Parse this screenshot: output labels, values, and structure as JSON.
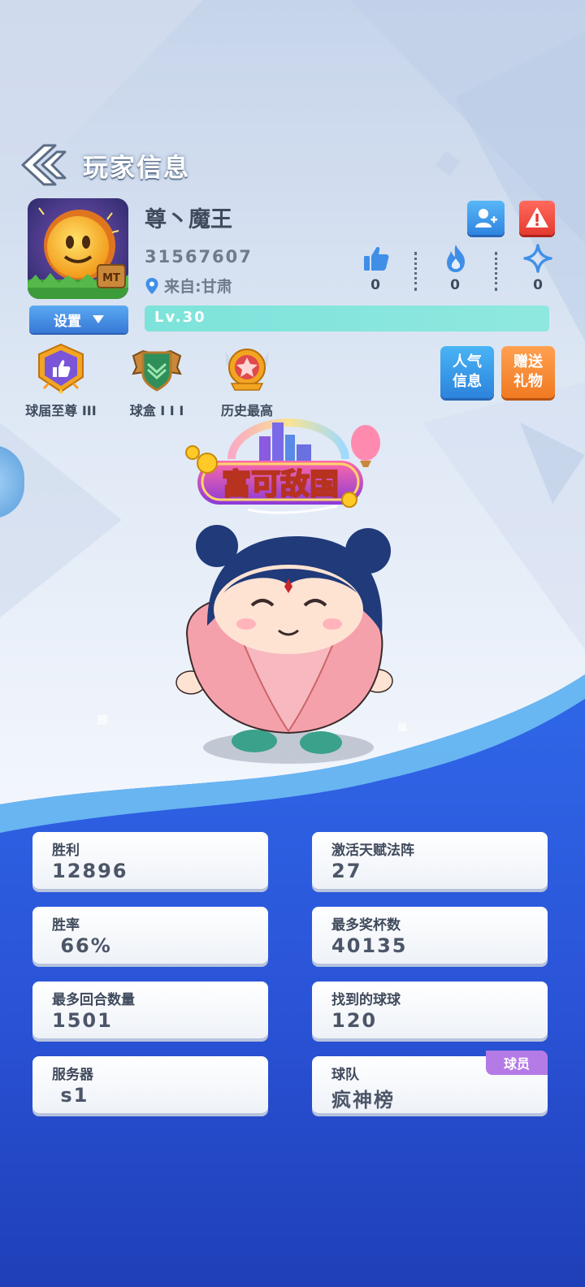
{
  "header": {
    "title": "玩家信息"
  },
  "player": {
    "avatar_badge": "MT",
    "name": "尊丶魔王",
    "id": "31567607",
    "location": "来自:甘肃",
    "level": "Lv.30"
  },
  "settings": {
    "label": "设置"
  },
  "stats": [
    {
      "icon": "thumbs-up-icon",
      "count": "0"
    },
    {
      "icon": "fire-icon",
      "count": "0"
    },
    {
      "icon": "sparkle-icon",
      "count": "0"
    }
  ],
  "badges": [
    {
      "label": "球届至尊 III"
    },
    {
      "label": "球盒 I I I"
    },
    {
      "label": "历史最高"
    }
  ],
  "actions": {
    "popularity": "人气信息",
    "gift": "赠送礼物"
  },
  "title_banner": {
    "text": "富可敌国"
  },
  "cards": [
    {
      "label": "胜利",
      "value": "12896"
    },
    {
      "label": "激活天赋法阵",
      "value": "27"
    },
    {
      "label": "胜率",
      "value": " 66%"
    },
    {
      "label": "最多奖杯数",
      "value": "40135"
    },
    {
      "label": "最多回合数量",
      "value": "1501"
    },
    {
      "label": "找到的球球",
      "value": "120"
    },
    {
      "label": "服务器",
      "value": " s1"
    },
    {
      "label": "球队",
      "value": "疯神榜",
      "tag": "球员"
    }
  ],
  "colors": {
    "accent_blue": "#2e85e0",
    "danger_red": "#e53a31",
    "gift_orange": "#f07a22",
    "level_teal": "#7de3da",
    "tag_purple": "#b47be6"
  }
}
